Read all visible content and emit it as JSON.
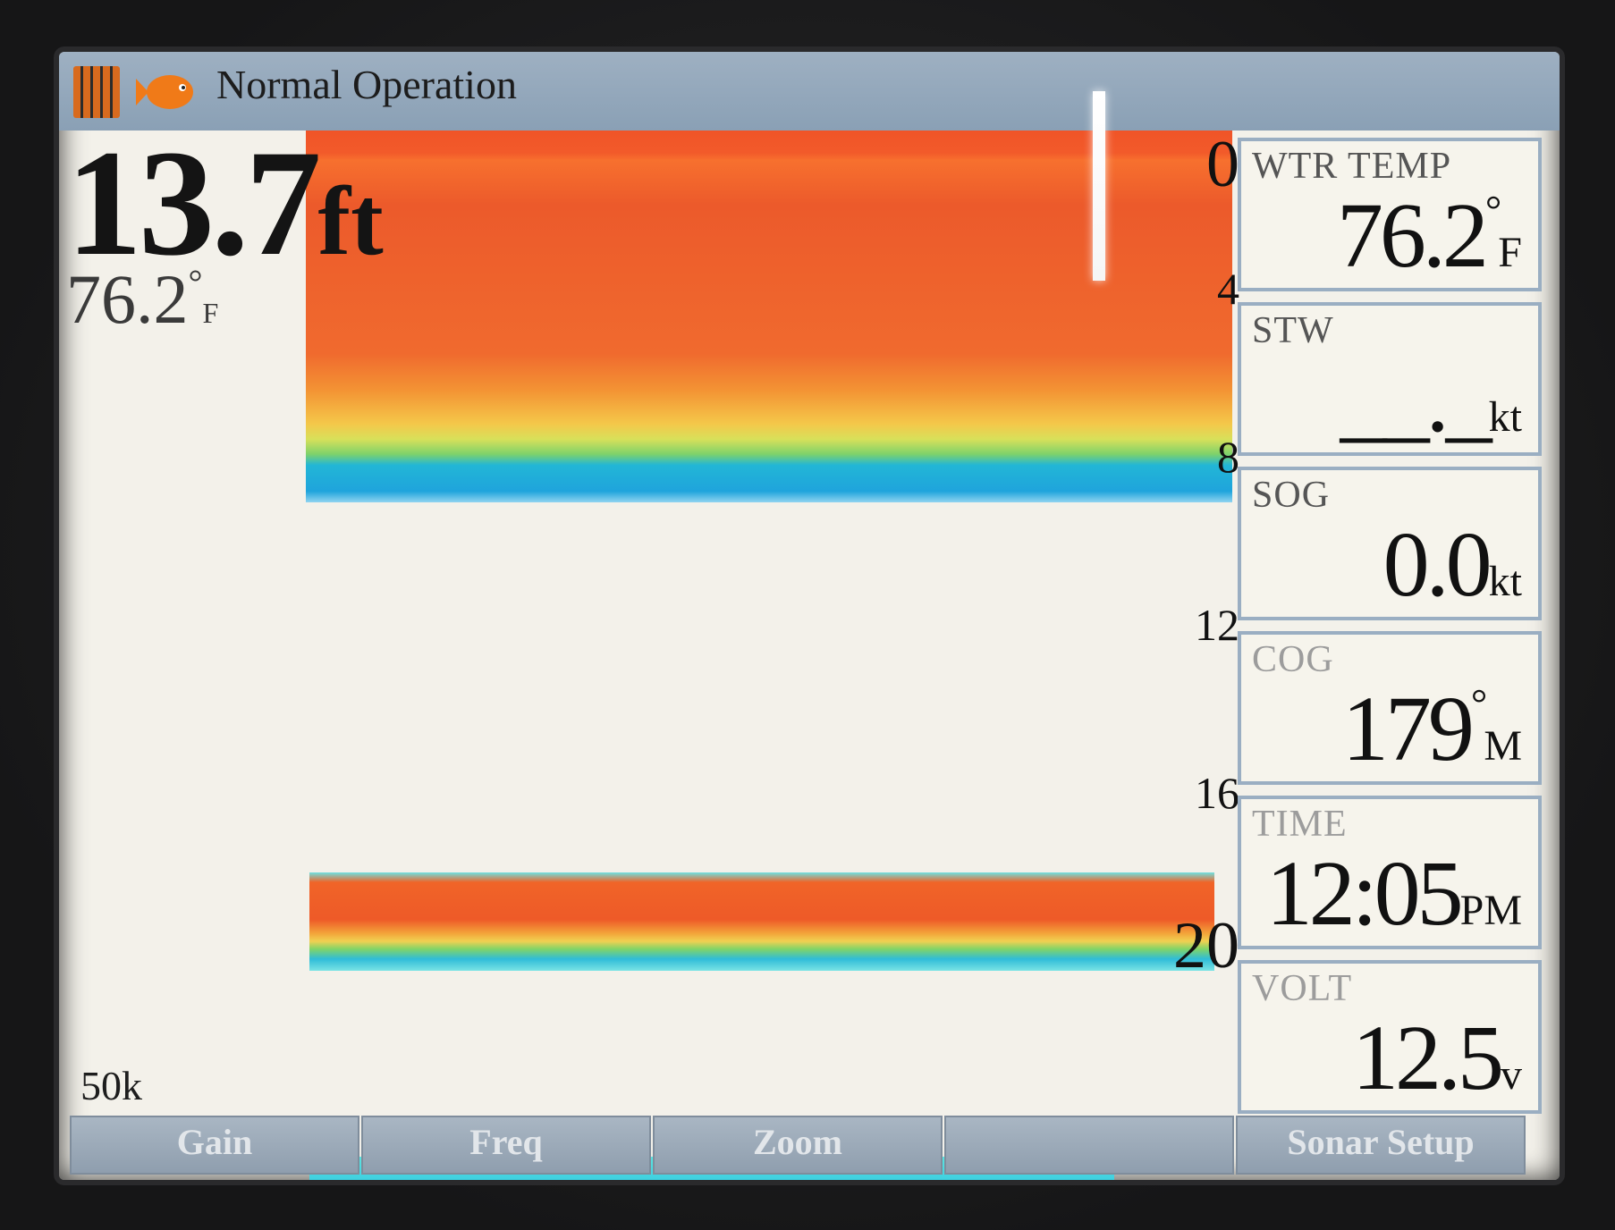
{
  "header": {
    "title": "Normal Operation",
    "logo_icon": "brand-logo-icon",
    "fish_icon": "fish-icon"
  },
  "depth_readout": {
    "value": "13.7",
    "unit": "ft"
  },
  "temp_readout": {
    "value": "76.2",
    "deg": "°",
    "unit": "F"
  },
  "frequency": "50k",
  "depth_scale": [
    "0",
    "4",
    "8",
    "12",
    "16",
    "20"
  ],
  "panel": [
    {
      "label": "WTR TEMP",
      "value": "76.2",
      "deg": "°",
      "unit": "F"
    },
    {
      "label": "STW",
      "value": "__._",
      "unit": "kt"
    },
    {
      "label": "SOG",
      "value": "0.0",
      "unit": "kt"
    },
    {
      "label": "COG",
      "value": "179",
      "deg": "°",
      "unit": "M"
    },
    {
      "label": "TIME",
      "value": "12:05",
      "unit": "PM"
    },
    {
      "label": "VOLT",
      "value": "12.5",
      "unit": "v"
    }
  ],
  "softkeys": [
    "Gain",
    "Freq",
    "Zoom",
    "",
    "Sonar Setup"
  ],
  "colors": {
    "sonar_red": "#f05428",
    "sonar_blue": "#1fa4dc",
    "title_bar": "#9eb0c2",
    "screen_bg": "#f3f1ea"
  }
}
